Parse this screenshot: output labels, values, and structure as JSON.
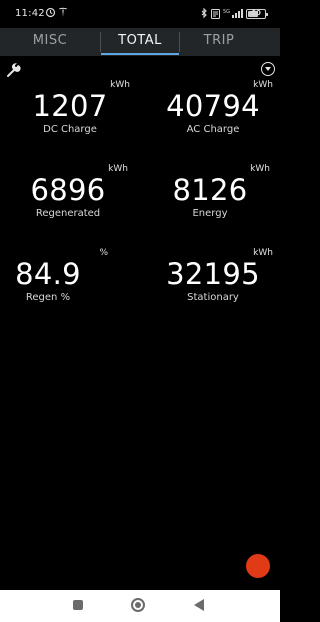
{
  "status_bar": {
    "time": "11:42",
    "battery": "60"
  },
  "tabs": [
    {
      "label": "MISC"
    },
    {
      "label": "TOTAL"
    },
    {
      "label": "TRIP"
    }
  ],
  "active_tab": "TOTAL",
  "stats": [
    {
      "value": "1207",
      "unit": "kWh",
      "label": "DC Charge"
    },
    {
      "value": "40794",
      "unit": "kWh",
      "label": "AC Charge"
    },
    {
      "value": "6896",
      "unit": "kWh",
      "label": "Regenerated"
    },
    {
      "value": "8126",
      "unit": "kWh",
      "label": "Energy"
    },
    {
      "value": "84.9",
      "unit": "%",
      "label": "Regen %"
    },
    {
      "value": "32195",
      "unit": "kWh",
      "label": "Stationary"
    }
  ],
  "colors": {
    "accent": "#5fa6e0",
    "fab": "#e03a16",
    "tab_background": "#222628"
  },
  "icons": [
    "wrench-icon",
    "dropdown-icon",
    "recents-icon",
    "home-icon",
    "back-icon"
  ]
}
